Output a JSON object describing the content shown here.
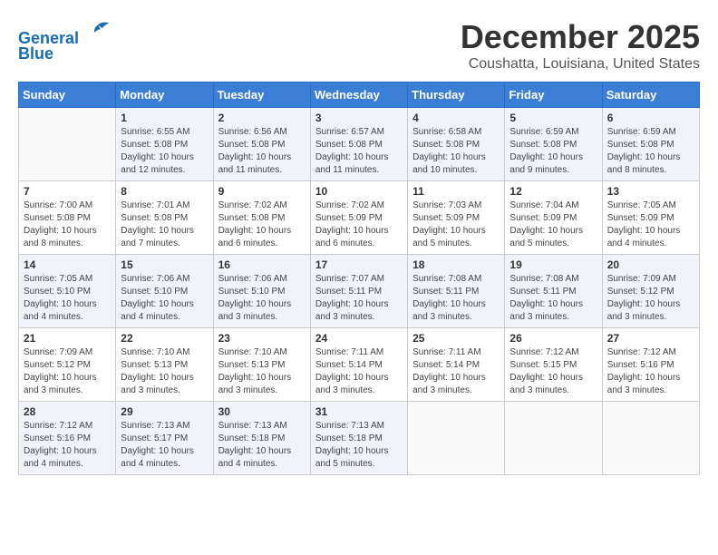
{
  "header": {
    "logo_line1": "General",
    "logo_line2": "Blue",
    "month_title": "December 2025",
    "location": "Coushatta, Louisiana, United States"
  },
  "weekdays": [
    "Sunday",
    "Monday",
    "Tuesday",
    "Wednesday",
    "Thursday",
    "Friday",
    "Saturday"
  ],
  "weeks": [
    [
      {
        "day": "",
        "info": ""
      },
      {
        "day": "1",
        "info": "Sunrise: 6:55 AM\nSunset: 5:08 PM\nDaylight: 10 hours\nand 12 minutes."
      },
      {
        "day": "2",
        "info": "Sunrise: 6:56 AM\nSunset: 5:08 PM\nDaylight: 10 hours\nand 11 minutes."
      },
      {
        "day": "3",
        "info": "Sunrise: 6:57 AM\nSunset: 5:08 PM\nDaylight: 10 hours\nand 11 minutes."
      },
      {
        "day": "4",
        "info": "Sunrise: 6:58 AM\nSunset: 5:08 PM\nDaylight: 10 hours\nand 10 minutes."
      },
      {
        "day": "5",
        "info": "Sunrise: 6:59 AM\nSunset: 5:08 PM\nDaylight: 10 hours\nand 9 minutes."
      },
      {
        "day": "6",
        "info": "Sunrise: 6:59 AM\nSunset: 5:08 PM\nDaylight: 10 hours\nand 8 minutes."
      }
    ],
    [
      {
        "day": "7",
        "info": "Sunrise: 7:00 AM\nSunset: 5:08 PM\nDaylight: 10 hours\nand 8 minutes."
      },
      {
        "day": "8",
        "info": "Sunrise: 7:01 AM\nSunset: 5:08 PM\nDaylight: 10 hours\nand 7 minutes."
      },
      {
        "day": "9",
        "info": "Sunrise: 7:02 AM\nSunset: 5:08 PM\nDaylight: 10 hours\nand 6 minutes."
      },
      {
        "day": "10",
        "info": "Sunrise: 7:02 AM\nSunset: 5:09 PM\nDaylight: 10 hours\nand 6 minutes."
      },
      {
        "day": "11",
        "info": "Sunrise: 7:03 AM\nSunset: 5:09 PM\nDaylight: 10 hours\nand 5 minutes."
      },
      {
        "day": "12",
        "info": "Sunrise: 7:04 AM\nSunset: 5:09 PM\nDaylight: 10 hours\nand 5 minutes."
      },
      {
        "day": "13",
        "info": "Sunrise: 7:05 AM\nSunset: 5:09 PM\nDaylight: 10 hours\nand 4 minutes."
      }
    ],
    [
      {
        "day": "14",
        "info": "Sunrise: 7:05 AM\nSunset: 5:10 PM\nDaylight: 10 hours\nand 4 minutes."
      },
      {
        "day": "15",
        "info": "Sunrise: 7:06 AM\nSunset: 5:10 PM\nDaylight: 10 hours\nand 4 minutes."
      },
      {
        "day": "16",
        "info": "Sunrise: 7:06 AM\nSunset: 5:10 PM\nDaylight: 10 hours\nand 3 minutes."
      },
      {
        "day": "17",
        "info": "Sunrise: 7:07 AM\nSunset: 5:11 PM\nDaylight: 10 hours\nand 3 minutes."
      },
      {
        "day": "18",
        "info": "Sunrise: 7:08 AM\nSunset: 5:11 PM\nDaylight: 10 hours\nand 3 minutes."
      },
      {
        "day": "19",
        "info": "Sunrise: 7:08 AM\nSunset: 5:11 PM\nDaylight: 10 hours\nand 3 minutes."
      },
      {
        "day": "20",
        "info": "Sunrise: 7:09 AM\nSunset: 5:12 PM\nDaylight: 10 hours\nand 3 minutes."
      }
    ],
    [
      {
        "day": "21",
        "info": "Sunrise: 7:09 AM\nSunset: 5:12 PM\nDaylight: 10 hours\nand 3 minutes."
      },
      {
        "day": "22",
        "info": "Sunrise: 7:10 AM\nSunset: 5:13 PM\nDaylight: 10 hours\nand 3 minutes."
      },
      {
        "day": "23",
        "info": "Sunrise: 7:10 AM\nSunset: 5:13 PM\nDaylight: 10 hours\nand 3 minutes."
      },
      {
        "day": "24",
        "info": "Sunrise: 7:11 AM\nSunset: 5:14 PM\nDaylight: 10 hours\nand 3 minutes."
      },
      {
        "day": "25",
        "info": "Sunrise: 7:11 AM\nSunset: 5:14 PM\nDaylight: 10 hours\nand 3 minutes."
      },
      {
        "day": "26",
        "info": "Sunrise: 7:12 AM\nSunset: 5:15 PM\nDaylight: 10 hours\nand 3 minutes."
      },
      {
        "day": "27",
        "info": "Sunrise: 7:12 AM\nSunset: 5:16 PM\nDaylight: 10 hours\nand 3 minutes."
      }
    ],
    [
      {
        "day": "28",
        "info": "Sunrise: 7:12 AM\nSunset: 5:16 PM\nDaylight: 10 hours\nand 4 minutes."
      },
      {
        "day": "29",
        "info": "Sunrise: 7:13 AM\nSunset: 5:17 PM\nDaylight: 10 hours\nand 4 minutes."
      },
      {
        "day": "30",
        "info": "Sunrise: 7:13 AM\nSunset: 5:18 PM\nDaylight: 10 hours\nand 4 minutes."
      },
      {
        "day": "31",
        "info": "Sunrise: 7:13 AM\nSunset: 5:18 PM\nDaylight: 10 hours\nand 5 minutes."
      },
      {
        "day": "",
        "info": ""
      },
      {
        "day": "",
        "info": ""
      },
      {
        "day": "",
        "info": ""
      }
    ]
  ]
}
